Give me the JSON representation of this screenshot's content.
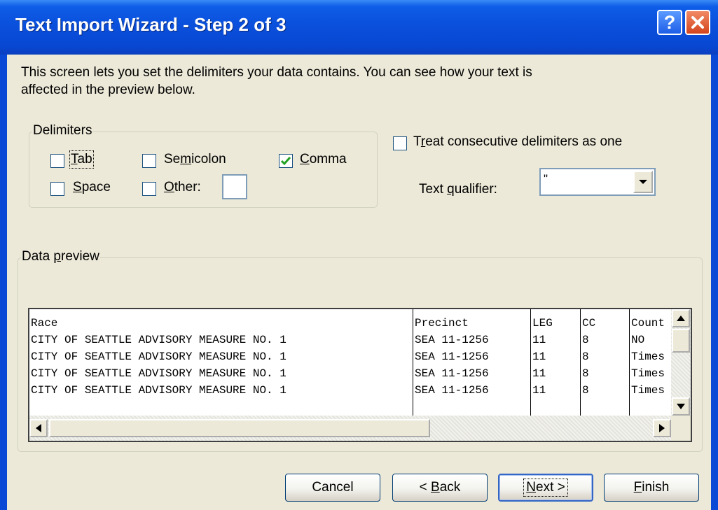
{
  "window": {
    "title": "Text Import Wizard - Step 2 of 3",
    "help_glyph": "?",
    "accent_title": "#0a50dc",
    "face": "#ece9d8"
  },
  "intro_text": "This screen lets you set the delimiters your data contains.  You can see how your text is affected in the preview below.",
  "delimiters": {
    "legend": "Delimiters",
    "tab": {
      "pre": "",
      "key": "T",
      "post": "ab",
      "checked": false
    },
    "semicolon": {
      "pre": "Se",
      "key": "m",
      "post": "icolon",
      "checked": false
    },
    "comma": {
      "pre": "",
      "key": "C",
      "post": "omma",
      "checked": true
    },
    "space": {
      "pre": "",
      "key": "S",
      "post": "pace",
      "checked": false
    },
    "other": {
      "pre": "",
      "key": "O",
      "post": "ther:",
      "checked": false,
      "value": ""
    }
  },
  "consecutive": {
    "pre": "T",
    "key": "r",
    "post": "eat consecutive delimiters as one",
    "checked": false
  },
  "qualifier": {
    "pre": "Text ",
    "key": "q",
    "post": "ualifier:",
    "value": "\""
  },
  "preview": {
    "legend_pre": "Data ",
    "legend_key": "p",
    "legend_post": "review",
    "columns": [
      {
        "cells": [
          "Race",
          "CITY OF SEATTLE ADVISORY MEASURE NO. 1",
          "CITY OF SEATTLE ADVISORY MEASURE NO. 1",
          "CITY OF SEATTLE ADVISORY MEASURE NO. 1",
          "CITY OF SEATTLE ADVISORY MEASURE NO. 1"
        ]
      },
      {
        "cells": [
          "Precinct",
          "SEA 11-1256",
          "SEA 11-1256",
          "SEA 11-1256",
          "SEA 11-1256"
        ]
      },
      {
        "cells": [
          "LEG",
          "11",
          "11",
          "11",
          "11"
        ]
      },
      {
        "cells": [
          "CC",
          "8",
          "8",
          "8",
          "8"
        ]
      },
      {
        "cells": [
          "Count",
          "NO",
          "Times",
          "Times",
          "Times"
        ]
      }
    ]
  },
  "buttons": {
    "cancel": {
      "pre": "Cancel",
      "key": "",
      "post": ""
    },
    "back": {
      "pre": "< ",
      "key": "B",
      "post": "ack"
    },
    "next": {
      "pre": "",
      "key": "N",
      "post": "ext >"
    },
    "finish": {
      "pre": "",
      "key": "F",
      "post": "inish"
    }
  }
}
